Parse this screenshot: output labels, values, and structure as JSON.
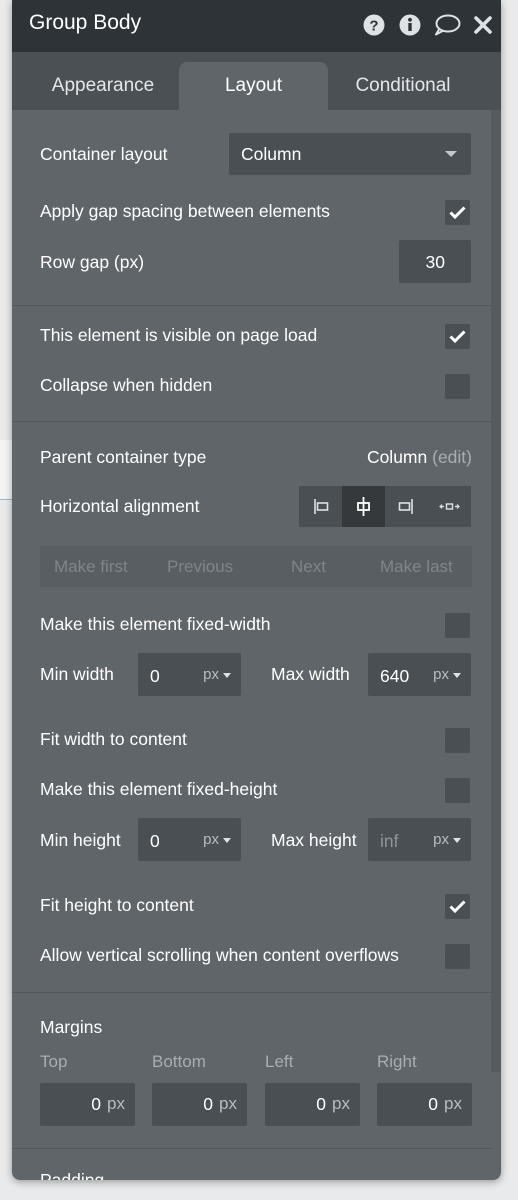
{
  "header": {
    "title": "Group Body",
    "icons": [
      "question-icon",
      "info-icon",
      "comment-icon",
      "close-icon"
    ]
  },
  "tabs": [
    {
      "label": "Appearance",
      "active": false
    },
    {
      "label": "Layout",
      "active": true
    },
    {
      "label": "Conditional",
      "active": false
    }
  ],
  "container": {
    "layout_label": "Container layout",
    "layout_value": "Column",
    "gap_label": "Apply gap spacing between elements",
    "gap_checked": true,
    "row_gap_label": "Row gap (px)",
    "row_gap_value": "30"
  },
  "visibility": {
    "visible_label": "This element is visible on page load",
    "visible_checked": true,
    "collapse_label": "Collapse when hidden",
    "collapse_checked": false
  },
  "parent": {
    "type_label": "Parent container type",
    "type_value": "Column",
    "edit_label": "(edit)",
    "align_label": "Horizontal alignment",
    "align_options": [
      "align-left-icon",
      "align-center-icon",
      "align-right-icon",
      "align-stretch-icon"
    ],
    "align_selected": "align-center-icon"
  },
  "order": {
    "make_first": "Make first",
    "previous": "Previous",
    "next": "Next",
    "make_last": "Make last"
  },
  "width": {
    "fixed_label": "Make this element fixed-width",
    "fixed_checked": false,
    "min_label": "Min width",
    "min_value": "0",
    "min_unit": "px",
    "max_label": "Max width",
    "max_value": "640",
    "max_unit": "px",
    "fit_label": "Fit width to content",
    "fit_checked": false
  },
  "height": {
    "fixed_label": "Make this element fixed-height",
    "fixed_checked": false,
    "min_label": "Min height",
    "min_value": "0",
    "min_unit": "px",
    "max_label": "Max height",
    "max_placeholder": "inf",
    "max_unit": "px",
    "fit_label": "Fit height to content",
    "fit_checked": true,
    "scroll_label": "Allow vertical scrolling when content overflows",
    "scroll_checked": false
  },
  "margins": {
    "title": "Margins",
    "top_label": "Top",
    "top_value": "0",
    "bottom_label": "Bottom",
    "bottom_value": "0",
    "left_label": "Left",
    "left_value": "0",
    "right_label": "Right",
    "right_value": "0",
    "unit": "px"
  },
  "padding": {
    "title": "Padding"
  },
  "colors": {
    "panel": "#5f6569",
    "titlebar": "#2e3337",
    "tabbar": "#4b5054",
    "field": "#4a4f53",
    "text": "#ffffff",
    "muted": "#a8adb1"
  }
}
